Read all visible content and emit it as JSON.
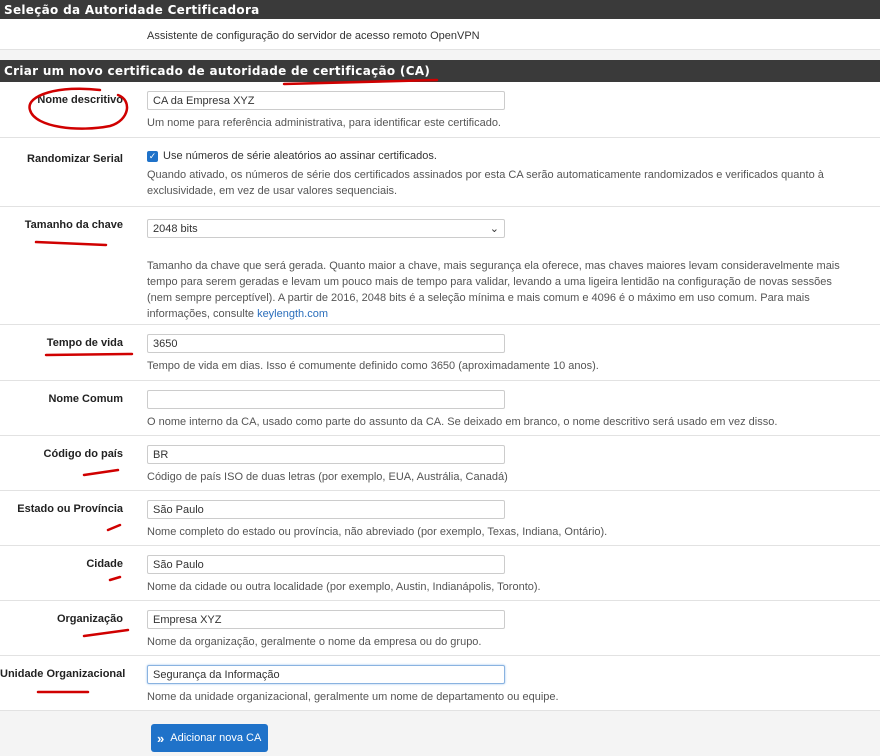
{
  "section1": {
    "title": "Seleção da Autoridade Certificadora",
    "description": "Assistente de configuração do servidor de acesso remoto OpenVPN"
  },
  "section2": {
    "title": "Criar um novo certificado de autoridade de certificação (CA)"
  },
  "fields": {
    "descr": {
      "label": "Nome descritivo",
      "value": "CA da Empresa XYZ",
      "help": "Um nome para referência administrativa, para identificar este certificado."
    },
    "serial": {
      "label": "Randomizar Serial",
      "checkbox_label": "Use números de série aleatórios ao assinar certificados.",
      "checked": true,
      "help": "Quando ativado, os números de série dos certificados assinados por esta CA serão automaticamente randomizados e verificados quanto à exclusividade, em vez de usar valores sequenciais."
    },
    "keylen": {
      "label": "Tamanho da chave",
      "value": "2048 bits",
      "help": "Tamanho da chave que será gerada. Quanto maior a chave, mais segurança ela oferece, mas chaves maiores levam consideravelmente mais tempo para serem geradas e levam um pouco mais de tempo para validar, levando a uma ligeira lentidão na configuração de novas sessões (nem sempre perceptível). A partir de 2016, 2048 bits é a seleção mínima e mais comum e 4096 é o máximo em uso comum. Para mais informações, consulte ",
      "link": "keylength.com"
    },
    "lifetime": {
      "label": "Tempo de vida",
      "value": "3650",
      "help": "Tempo de vida em dias. Isso é comumente definido como 3650 (aproximadamente 10 anos)."
    },
    "cn": {
      "label": "Nome Comum",
      "value": "",
      "help": "O nome interno da CA, usado como parte do assunto da CA. Se deixado em branco, o nome descritivo será usado em vez disso."
    },
    "country": {
      "label": "Código do país",
      "value": "BR",
      "help": "Código de país ISO de duas letras (por exemplo, EUA, Austrália, Canadá)"
    },
    "state": {
      "label": "Estado ou Província",
      "value": "São Paulo",
      "help": "Nome completo do estado ou província, não abreviado (por exemplo, Texas, Indiana, Ontário)."
    },
    "city": {
      "label": "Cidade",
      "value": "São Paulo",
      "help": "Nome da cidade ou outra localidade (por exemplo, Austin, Indianápolis, Toronto)."
    },
    "org": {
      "label": "Organização",
      "value": "Empresa XYZ",
      "help": "Nome da organização, geralmente o nome da empresa ou do grupo."
    },
    "ou": {
      "label": "Unidade Organizacional",
      "value": "Segurança da Informação",
      "help": "Nome da unidade organizacional, geralmente um nome de departamento ou equipe."
    }
  },
  "button": {
    "label": "Adicionar nova CA",
    "icon": "double-chevron-right-icon"
  },
  "colors": {
    "header": "#3a3a3a",
    "button": "#1f72c9",
    "annotation": "#d00000"
  }
}
